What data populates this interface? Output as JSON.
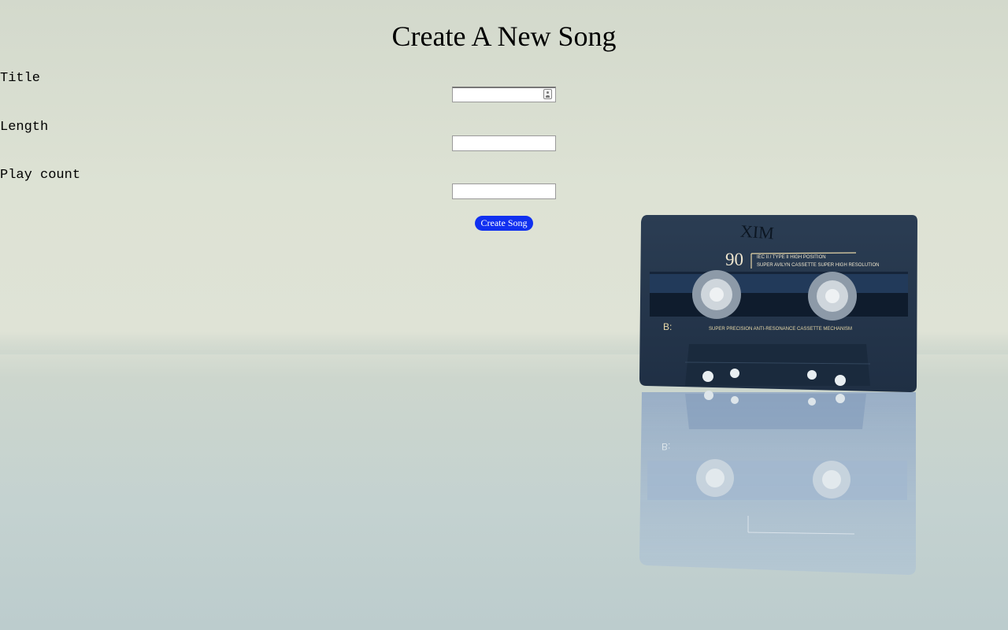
{
  "page": {
    "heading": "Create A New Song"
  },
  "form": {
    "fields": [
      {
        "label": "Title",
        "value": "",
        "placeholder": ""
      },
      {
        "label": "Length",
        "value": "",
        "placeholder": ""
      },
      {
        "label": "Play count",
        "value": "",
        "placeholder": ""
      }
    ],
    "submit_label": "Create Song"
  },
  "cassette": {
    "label_top_number": "90",
    "label_top_line1": "IEC II / TYPE II  HIGH POSITION",
    "label_top_line2": "SUPER AVILYN CASSETTE SUPER HIGH RESOLUTION",
    "side_label": "B:",
    "mechanism_text": "SUPER PRECISION ANTI-RESONANCE CASSETTE MECHANISM",
    "handwriting": "XIM"
  },
  "colors": {
    "button": "#1030f0",
    "cassette_body": "#2a3c52"
  }
}
